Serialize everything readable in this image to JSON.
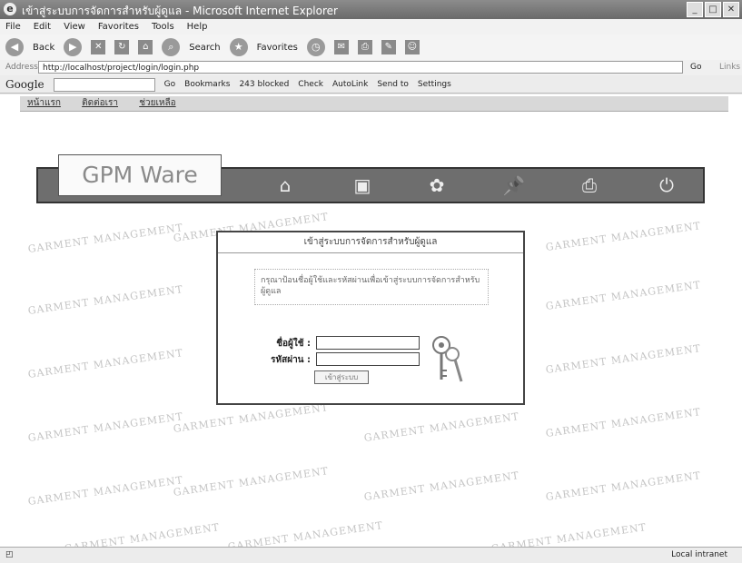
{
  "window": {
    "title": "เข้าสู่ระบบการจัดการสำหรับผู้ดูแล - Microsoft Internet Explorer",
    "controls": [
      "_",
      "□",
      "✕"
    ]
  },
  "menu": [
    "File",
    "Edit",
    "View",
    "Favorites",
    "Tools",
    "Help"
  ],
  "toolbar": {
    "back": "Back",
    "search": "Search",
    "favorites": "Favorites"
  },
  "address": {
    "label": "Address",
    "url": "http://localhost/project/login/login.php",
    "go": "Go",
    "links": "Links"
  },
  "google": {
    "logo": "Google",
    "go": "Go",
    "bookmarks": "Bookmarks",
    "blocked": "243 blocked",
    "check": "Check",
    "autolink": "AutoLink",
    "sendto": "Send to",
    "settings": "Settings"
  },
  "site": {
    "nav": [
      "หน้าแรก",
      "ติดต่อเรา",
      "ช่วยเหลือ"
    ],
    "logo": "GPM Ware",
    "watermark": "GARMENT MANAGEMENT",
    "header_icons": [
      "home-icon",
      "window-icon",
      "clothes-icon",
      "pin-icon",
      "printer-icon",
      "power-icon"
    ]
  },
  "login": {
    "title": "เข้าสู่ระบบการจัดการสำหรับผู้ดูแล",
    "message": "กรุณาป้อนชื่อผู้ใช้และรหัสผ่านเพื่อเข้าสู่ระบบการจัดการสำหรับผู้ดูแล",
    "username_label": "ชื่อผู้ใช้ :",
    "password_label": "รหัสผ่าน :",
    "username_value": "",
    "password_value": "",
    "submit_label": "เข้าสู่ระบบ"
  },
  "status": {
    "left": "",
    "zone": "Local intranet"
  }
}
